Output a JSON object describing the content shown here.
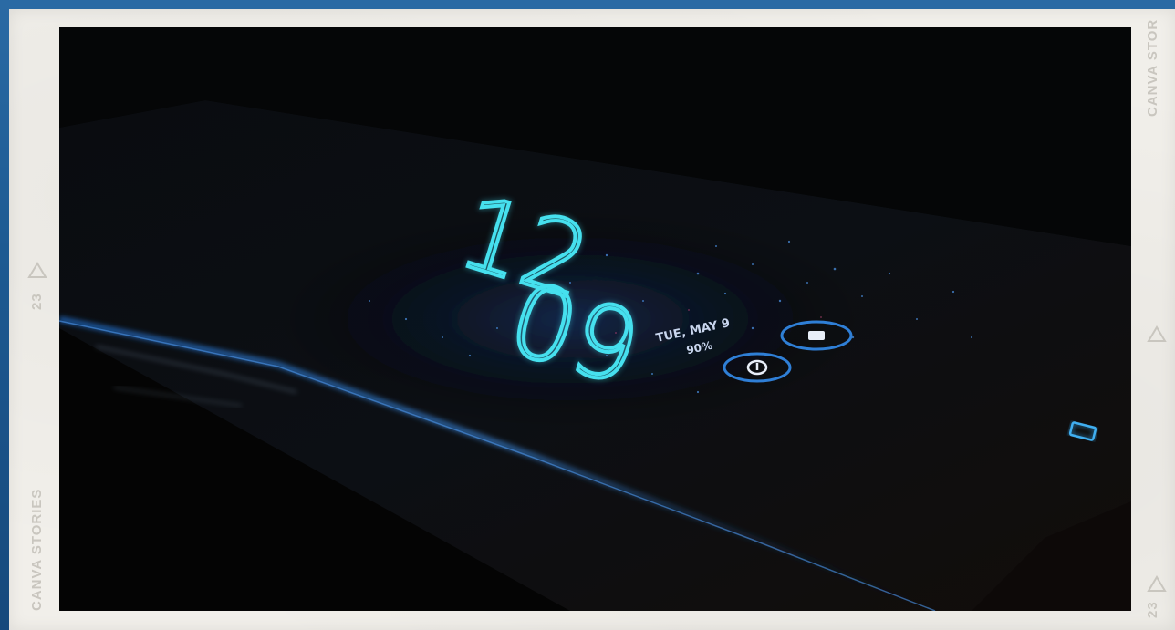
{
  "film": {
    "brand_left": "CANVA STORIES",
    "brand_right": "CANVA STOR",
    "frame_number_left": "23",
    "frame_number_right": "23"
  },
  "phone_screen": {
    "clock_hours": "12",
    "clock_minutes": "09",
    "date_text": "TUE, MAY 9",
    "battery_text": "90%"
  },
  "icons": [
    "triangle-icon",
    "camera-icon",
    "power-icon",
    "recent-apps-icon"
  ],
  "colors": {
    "background": "#1f5f9a",
    "film_border": "#f1efea",
    "clock_glow": "#3cd6e6",
    "accent_blue": "#2f7fd6"
  }
}
